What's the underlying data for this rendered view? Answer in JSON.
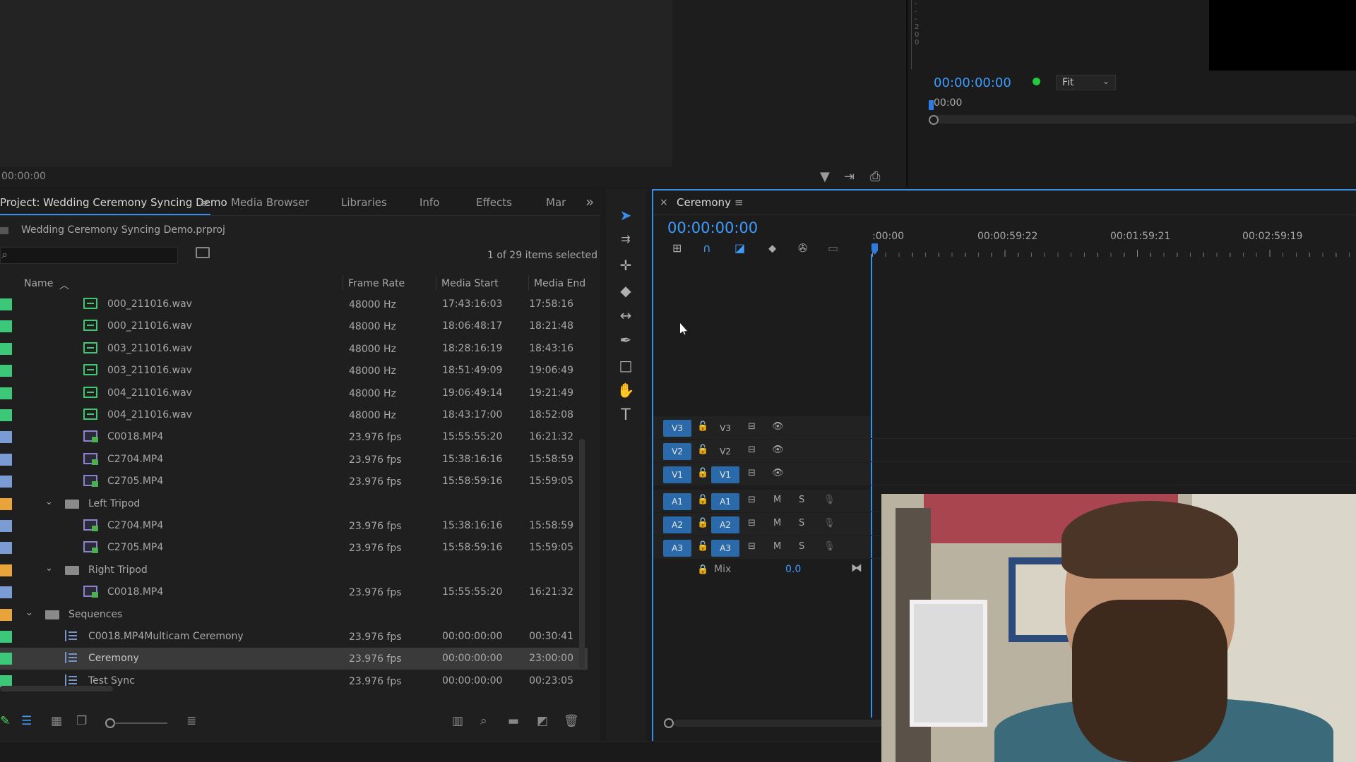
{
  "source_monitor": {
    "timecode": "00:00:00"
  },
  "program_monitor": {
    "timecode": "00:00:00:00",
    "fit_label": "Fit",
    "ruler_label": "00:00",
    "vu_labels": [
      "-",
      "-",
      "-",
      "2",
      "0",
      "0"
    ]
  },
  "project": {
    "tabs": [
      {
        "label": "Project: Wedding Ceremony Syncing Demo"
      },
      {
        "label": "Media Browser"
      },
      {
        "label": "Libraries"
      },
      {
        "label": "Info"
      },
      {
        "label": "Effects"
      },
      {
        "label": "Mar"
      }
    ],
    "menu_icon": "hamburger-icon",
    "overflow_label": "»",
    "file_name": "Wedding Ceremony Syncing Demo.prproj",
    "items_selected": "1 of 29 items selected",
    "columns": {
      "name": "Name",
      "frame_rate": "Frame Rate",
      "media_start": "Media Start",
      "media_end": "Media End"
    },
    "rows": [
      {
        "swatch": "#3cc878",
        "type": "audio",
        "indent": 1,
        "name": "000_211016.wav",
        "frame_rate": "48000 Hz",
        "media_start": "17:43:16:03",
        "media_end": "17:58:16"
      },
      {
        "swatch": "#3cc878",
        "type": "audio",
        "indent": 1,
        "name": "000_211016.wav",
        "frame_rate": "48000 Hz",
        "media_start": "18:06:48:17",
        "media_end": "18:21:48"
      },
      {
        "swatch": "#3cc878",
        "type": "audio",
        "indent": 1,
        "name": "003_211016.wav",
        "frame_rate": "48000 Hz",
        "media_start": "18:28:16:19",
        "media_end": "18:43:16"
      },
      {
        "swatch": "#3cc878",
        "type": "audio",
        "indent": 1,
        "name": "003_211016.wav",
        "frame_rate": "48000 Hz",
        "media_start": "18:51:49:09",
        "media_end": "19:06:49"
      },
      {
        "swatch": "#3cc878",
        "type": "audio",
        "indent": 1,
        "name": "004_211016.wav",
        "frame_rate": "48000 Hz",
        "media_start": "19:06:49:14",
        "media_end": "19:21:49"
      },
      {
        "swatch": "#3cc878",
        "type": "audio",
        "indent": 1,
        "name": "004_211016.wav",
        "frame_rate": "48000 Hz",
        "media_start": "18:43:17:00",
        "media_end": "18:52:08"
      },
      {
        "swatch": "#7b9bd4",
        "type": "video",
        "indent": 1,
        "name": "C0018.MP4",
        "frame_rate": "23.976 fps",
        "media_start": "15:55:55:20",
        "media_end": "16:21:32"
      },
      {
        "swatch": "#7b9bd4",
        "type": "video",
        "indent": 1,
        "name": "C2704.MP4",
        "frame_rate": "23.976 fps",
        "media_start": "15:38:16:16",
        "media_end": "15:58:59"
      },
      {
        "swatch": "#7b9bd4",
        "type": "video",
        "indent": 1,
        "name": "C2705.MP4",
        "frame_rate": "23.976 fps",
        "media_start": "15:58:59:16",
        "media_end": "15:59:05"
      },
      {
        "swatch": "#e8a43a",
        "type": "folder",
        "indent": 0.5,
        "name": "Left Tripod",
        "frame_rate": "",
        "media_start": "",
        "media_end": ""
      },
      {
        "swatch": "#7b9bd4",
        "type": "video",
        "indent": 1,
        "name": "C2704.MP4",
        "frame_rate": "23.976 fps",
        "media_start": "15:38:16:16",
        "media_end": "15:58:59"
      },
      {
        "swatch": "#7b9bd4",
        "type": "video",
        "indent": 1,
        "name": "C2705.MP4",
        "frame_rate": "23.976 fps",
        "media_start": "15:58:59:16",
        "media_end": "15:59:05"
      },
      {
        "swatch": "#e8a43a",
        "type": "folder",
        "indent": 0.5,
        "name": "Right Tripod",
        "frame_rate": "",
        "media_start": "",
        "media_end": ""
      },
      {
        "swatch": "#7b9bd4",
        "type": "video",
        "indent": 1,
        "name": "C0018.MP4",
        "frame_rate": "23.976 fps",
        "media_start": "15:55:55:20",
        "media_end": "16:21:32"
      },
      {
        "swatch": "#e8a43a",
        "type": "folder",
        "indent": 0,
        "name": "Sequences",
        "frame_rate": "",
        "media_start": "",
        "media_end": ""
      },
      {
        "swatch": "#3cc878",
        "type": "sequence",
        "indent": 0.5,
        "name": "C0018.MP4Multicam Ceremony",
        "frame_rate": "23.976 fps",
        "media_start": "00:00:00:00",
        "media_end": "00:30:41"
      },
      {
        "swatch": "#3cc878",
        "type": "sequence",
        "indent": 0.5,
        "name": "Ceremony",
        "frame_rate": "23.976 fps",
        "media_start": "00:00:00:00",
        "media_end": "23:00:00",
        "selected": true
      },
      {
        "swatch": "#3cc878",
        "type": "sequence",
        "indent": 0.5,
        "name": "Test Sync",
        "frame_rate": "23.976 fps",
        "media_start": "00:00:00:00",
        "media_end": "00:23:05"
      }
    ]
  },
  "tools": [
    "selection-tool",
    "track-select-tool",
    "ripple-edit-tool",
    "razor-tool",
    "slip-tool",
    "pen-tool",
    "rectangle-tool",
    "hand-tool",
    "type-tool"
  ],
  "timeline": {
    "sequence_name": "Ceremony",
    "close_label": "×",
    "menu_label": "≡",
    "timecode": "00:00:00:00",
    "ruler_labels": [
      ":00:00",
      "00:00:59:22",
      "00:01:59:21",
      "00:02:59:19"
    ],
    "video_tracks": [
      {
        "source": "V3",
        "target": "V3",
        "target_on": false
      },
      {
        "source": "V2",
        "target": "V2",
        "target_on": false
      },
      {
        "source": "V1",
        "target": "V1",
        "target_on": true
      }
    ],
    "audio_tracks": [
      {
        "source": "A1",
        "target": "A1"
      },
      {
        "source": "A2",
        "target": "A2"
      },
      {
        "source": "A3",
        "target": "A3"
      }
    ],
    "mute_label": "M",
    "solo_label": "S",
    "mix_label": "Mix",
    "mix_value": "0.0"
  }
}
